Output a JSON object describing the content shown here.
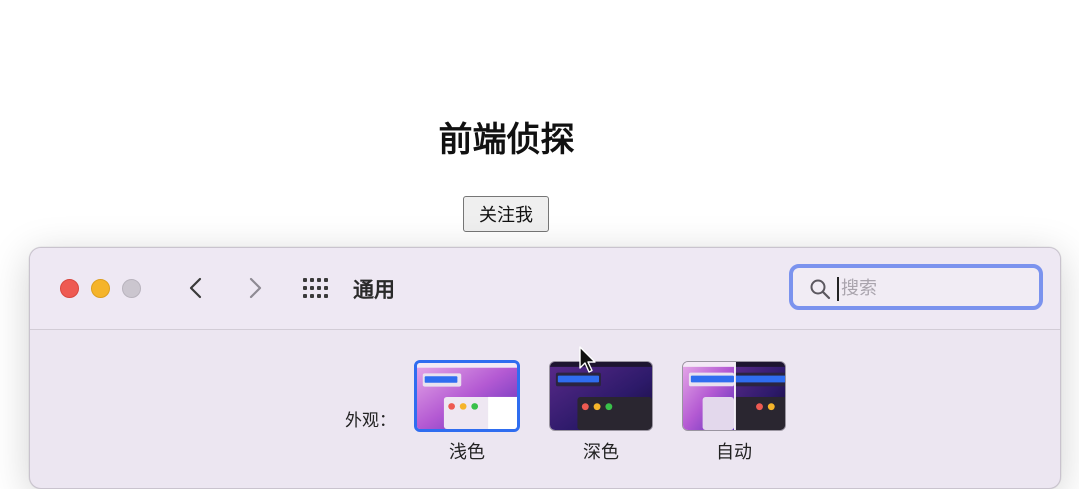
{
  "page": {
    "title": "前端侦探",
    "follow_label": "关注我"
  },
  "window": {
    "title": "通用",
    "search": {
      "value": "",
      "placeholder": "搜索"
    },
    "icons": {
      "back": "chevron-left-icon",
      "forward": "chevron-right-icon",
      "grid": "grid-icon",
      "search": "search-icon"
    },
    "traffic_lights": {
      "close": "#ee5a52",
      "minimize": "#f5b42a",
      "zoom": "#cbc6cf"
    },
    "accent": "#2f6df0"
  },
  "appearance": {
    "label": "外观：",
    "options": [
      {
        "label": "浅色",
        "selected": true
      },
      {
        "label": "深色",
        "selected": false
      },
      {
        "label": "自动",
        "selected": false
      }
    ]
  }
}
